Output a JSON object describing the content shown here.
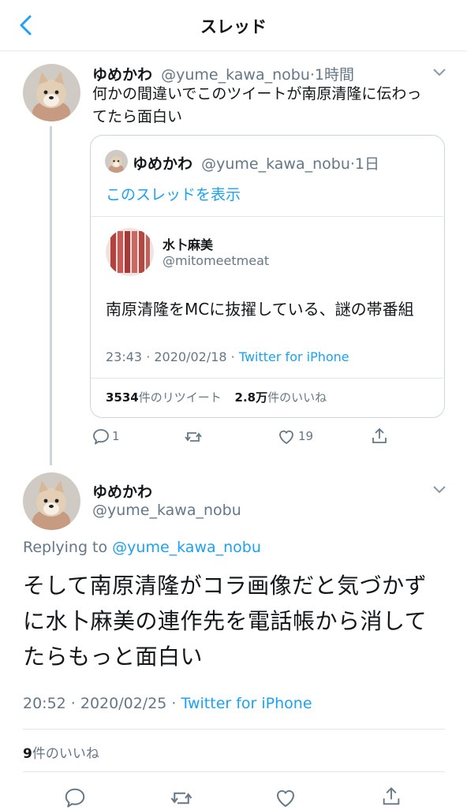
{
  "header": {
    "title": "スレッド"
  },
  "parent_tweet": {
    "name": "ゆめかわ",
    "handle": "@yume_kawa_nobu",
    "time": "·1時間",
    "text_line1": "何かの間違いでこのツイートが南原清隆に伝わっ",
    "text_line2": "てたら面白い",
    "actions": {
      "reply_count": "1",
      "retweet_count": "",
      "like_count": "19"
    }
  },
  "quoted_tweet": {
    "author_name": "ゆめかわ",
    "author_handle": "@yume_kawa_nobu",
    "author_time": "·1日",
    "show_thread": "このスレッドを表示",
    "inner_name": "水卜麻美",
    "inner_handle": "@mitomeetmeat",
    "inner_text": "南原清隆をMCに抜擢している、謎の帯番組",
    "timestamp": "23:43 · 2020/02/18 · ",
    "source": "Twitter for iPhone",
    "retweets_num": "3534",
    "retweets_label": "件のリツイート",
    "likes_num": "2.8万",
    "likes_label": "件のいいね"
  },
  "main_tweet": {
    "name": "ゆめかわ",
    "handle": "@yume_kawa_nobu",
    "replying_prefix": "Replying to ",
    "replying_handle": "@yume_kawa_nobu",
    "text_line1": "そして南原清隆がコラ画像だと気づかず",
    "text_line2": "に水卜麻美の連作先を電話帳から消して",
    "text_line3": "たらもっと面白い",
    "timestamp": "20:52 · 2020/02/25 · ",
    "source": "Twitter for iPhone",
    "likes_num": "9",
    "likes_label": "件のいいね"
  },
  "colors": {
    "accent": "#1da1f2",
    "secondary": "#657786",
    "border": "#ccd6dd"
  }
}
